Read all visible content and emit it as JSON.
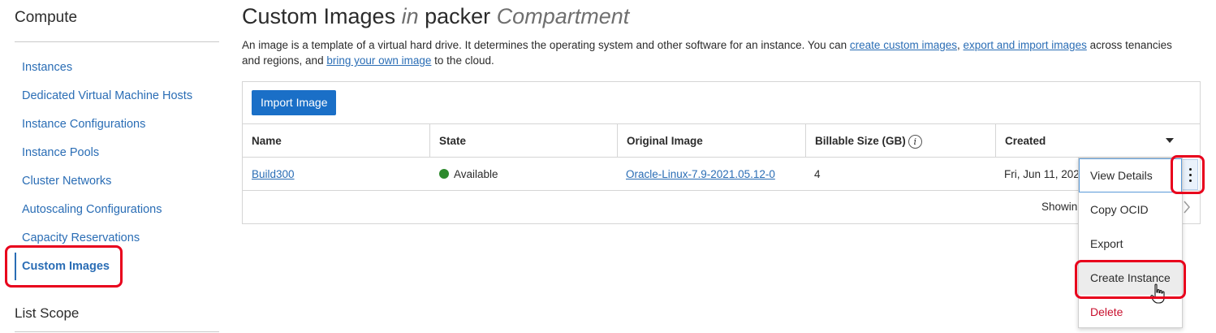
{
  "sidebar": {
    "title": "Compute",
    "items": [
      {
        "label": "Instances"
      },
      {
        "label": "Dedicated Virtual Machine Hosts"
      },
      {
        "label": "Instance Configurations"
      },
      {
        "label": "Instance Pools"
      },
      {
        "label": "Cluster Networks"
      },
      {
        "label": "Autoscaling Configurations"
      },
      {
        "label": "Capacity Reservations"
      },
      {
        "label": "Custom Images"
      }
    ],
    "active_item": "Custom Images",
    "scope_title": "List Scope"
  },
  "header": {
    "title_main": "Custom Images",
    "title_in": "in",
    "title_compartment_name": "packer",
    "title_compartment_label": "Compartment"
  },
  "description": {
    "part1": "An image is a template of a virtual hard drive. It determines the operating system and other software for an instance. You can ",
    "link1": "create custom images",
    "part2": ", ",
    "link2": "export and import images",
    "part3": " across tenancies and regions, and ",
    "link3": "bring your own image",
    "part4": " to the cloud."
  },
  "toolbar": {
    "import_label": "Import Image"
  },
  "table": {
    "columns": [
      "Name",
      "State",
      "Original Image",
      "Billable Size (GB)",
      "Created"
    ],
    "info_icon": "i",
    "rows": [
      {
        "name": "Build300",
        "state": "Available",
        "original_image": "Oracle-Linux-7.9-2021.05.12-0",
        "billable_size": "4",
        "created": "Fri, Jun 11, 202"
      }
    ],
    "footer_text": "Showin"
  },
  "actions_menu": {
    "items": [
      {
        "label": "View Details"
      },
      {
        "label": "Copy OCID"
      },
      {
        "label": "Export"
      },
      {
        "label": "Create Instance"
      },
      {
        "label": "Delete"
      }
    ]
  },
  "colors": {
    "link": "#2a6db5",
    "primary_button": "#1a6fc7",
    "status_available": "#2d8a2d",
    "danger": "#c8102e",
    "annotation": "#e8001c"
  }
}
